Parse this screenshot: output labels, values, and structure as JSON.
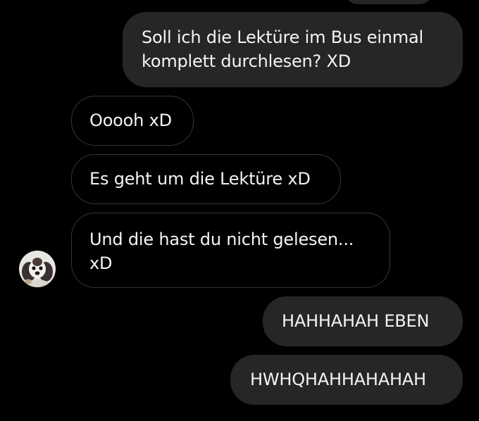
{
  "theme": {
    "background": "#000000",
    "sent_bubble": "#262626",
    "received_border": "#363636",
    "text": "#f4f4f4"
  },
  "messages": [
    {
      "direction": "sent",
      "text": "Soll ich die Lektüre im Bus einmal\nkomplett durchlesen? XD"
    },
    {
      "direction": "received",
      "text": "Ooooh xD"
    },
    {
      "direction": "received",
      "text": "Es geht um die Lektüre xD"
    },
    {
      "direction": "received",
      "text": "Und die hast du nicht gelesen...\nxD"
    },
    {
      "direction": "sent",
      "text": "HAHHAHAH EBEN"
    },
    {
      "direction": "sent",
      "text": "HWHQHAHHAHAHAH"
    }
  ],
  "contact": {
    "avatar_icon": "dog-avatar-icon"
  }
}
